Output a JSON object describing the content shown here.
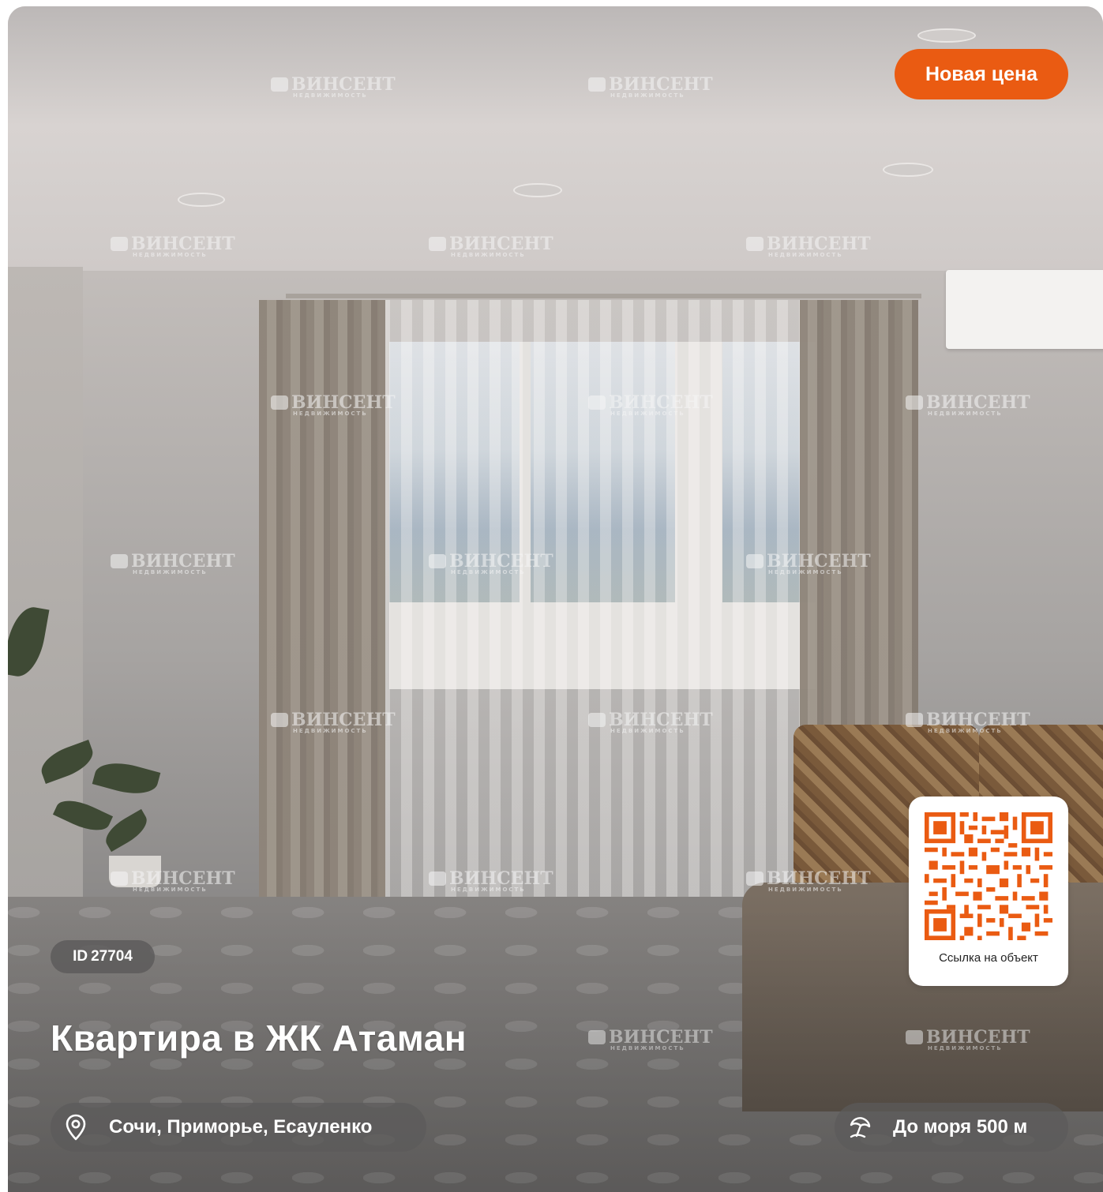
{
  "listing": {
    "badge_label": "Новая цена",
    "id_prefix": "ID",
    "id_value": "27704",
    "title": "Квартира в ЖК Атаман",
    "address": "Сочи, Приморье, Есауленко",
    "sea_distance": "До моря 500 м",
    "qr_caption": "Ссылка на объект"
  },
  "photo": {
    "watermark_brand": "ВИНСЕНТ",
    "watermark_sub": "НЕДВИЖИМОСТЬ"
  },
  "icons": {
    "address": "map-pin-icon",
    "sea": "beach-umbrella-icon",
    "qr": "qr-code-icon"
  },
  "colors": {
    "accent": "#ea5b12",
    "chip_bg": "#5a5858",
    "text_on_dark": "#ffffff"
  }
}
